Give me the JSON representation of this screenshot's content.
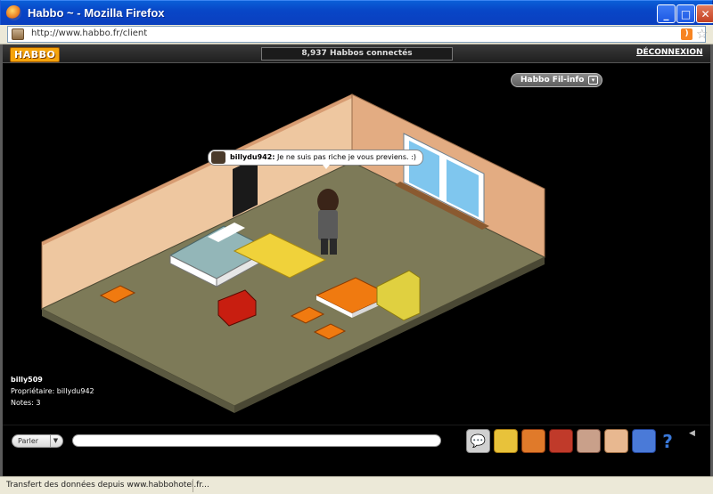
{
  "browser": {
    "window_title": "Habbo ~ - Mozilla Firefox",
    "url": "http://www.habbo.fr/client",
    "status_text": "Transfert des données depuis www.habbohotel.fr..."
  },
  "client": {
    "logo": "HABBO",
    "online_count": "8,937 Habbos connectés",
    "logout": "DÉCONNEXION",
    "fil_info": "Habbo Fil-info"
  },
  "chat": {
    "username": "billydu942:",
    "message": "Je ne suis pas riche je vous previens. :)"
  },
  "room_info": {
    "name": "billy509",
    "owner": "Propriétaire: billydu942",
    "rating": "Notes: 3"
  },
  "toolbar": {
    "talk_mode": "Parler",
    "icons": [
      "chat-icon",
      "profile-icon",
      "navigator-icon",
      "catalogue-icon",
      "inventory-icon",
      "trade-hand-icon",
      "games-icon",
      "help-icon"
    ]
  },
  "colors": {
    "floor": "#7d7a58",
    "wall_left": "#eec7a0",
    "wall_right": "#e3ac82",
    "habbo_orange": "#f5a30b"
  }
}
